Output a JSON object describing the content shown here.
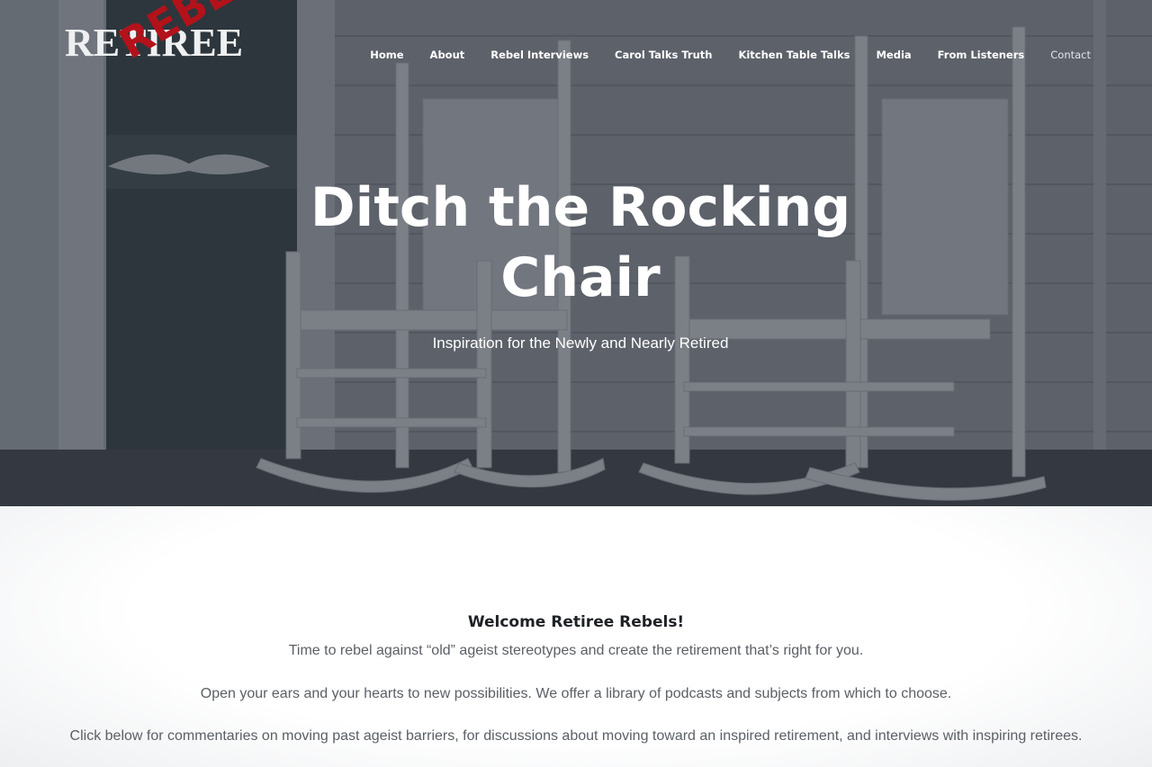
{
  "brand": {
    "logo_main": "RETIREE",
    "logo_accent": "REBELS"
  },
  "nav": {
    "items": [
      {
        "label": "Home"
      },
      {
        "label": "About"
      },
      {
        "label": "Rebel Interviews"
      },
      {
        "label": "Carol Talks Truth"
      },
      {
        "label": "Kitchen Table Talks"
      },
      {
        "label": "Media"
      },
      {
        "label": "From Listeners"
      },
      {
        "label": "Contact"
      }
    ]
  },
  "hero": {
    "title": "Ditch the Rocking Chair",
    "subtitle": "Inspiration for the Newly and Nearly Retired"
  },
  "welcome": {
    "heading": "Welcome Retiree Rebels!",
    "paragraphs": [
      "Time to rebel against “old” ageist stereotypes and create the retirement that’s right for you.",
      "Open your ears and your hearts to new possibilities. We offer a library of podcasts and subjects from which to choose.",
      "Click below for commentaries on moving past ageist barriers, for discussions about moving toward an inspired retirement, and interviews with inspiring retirees."
    ]
  },
  "colors": {
    "overlay": "#3a4048",
    "logo_accent": "#b3121b",
    "text_muted": "#5b6066",
    "heading": "#1e2226"
  }
}
